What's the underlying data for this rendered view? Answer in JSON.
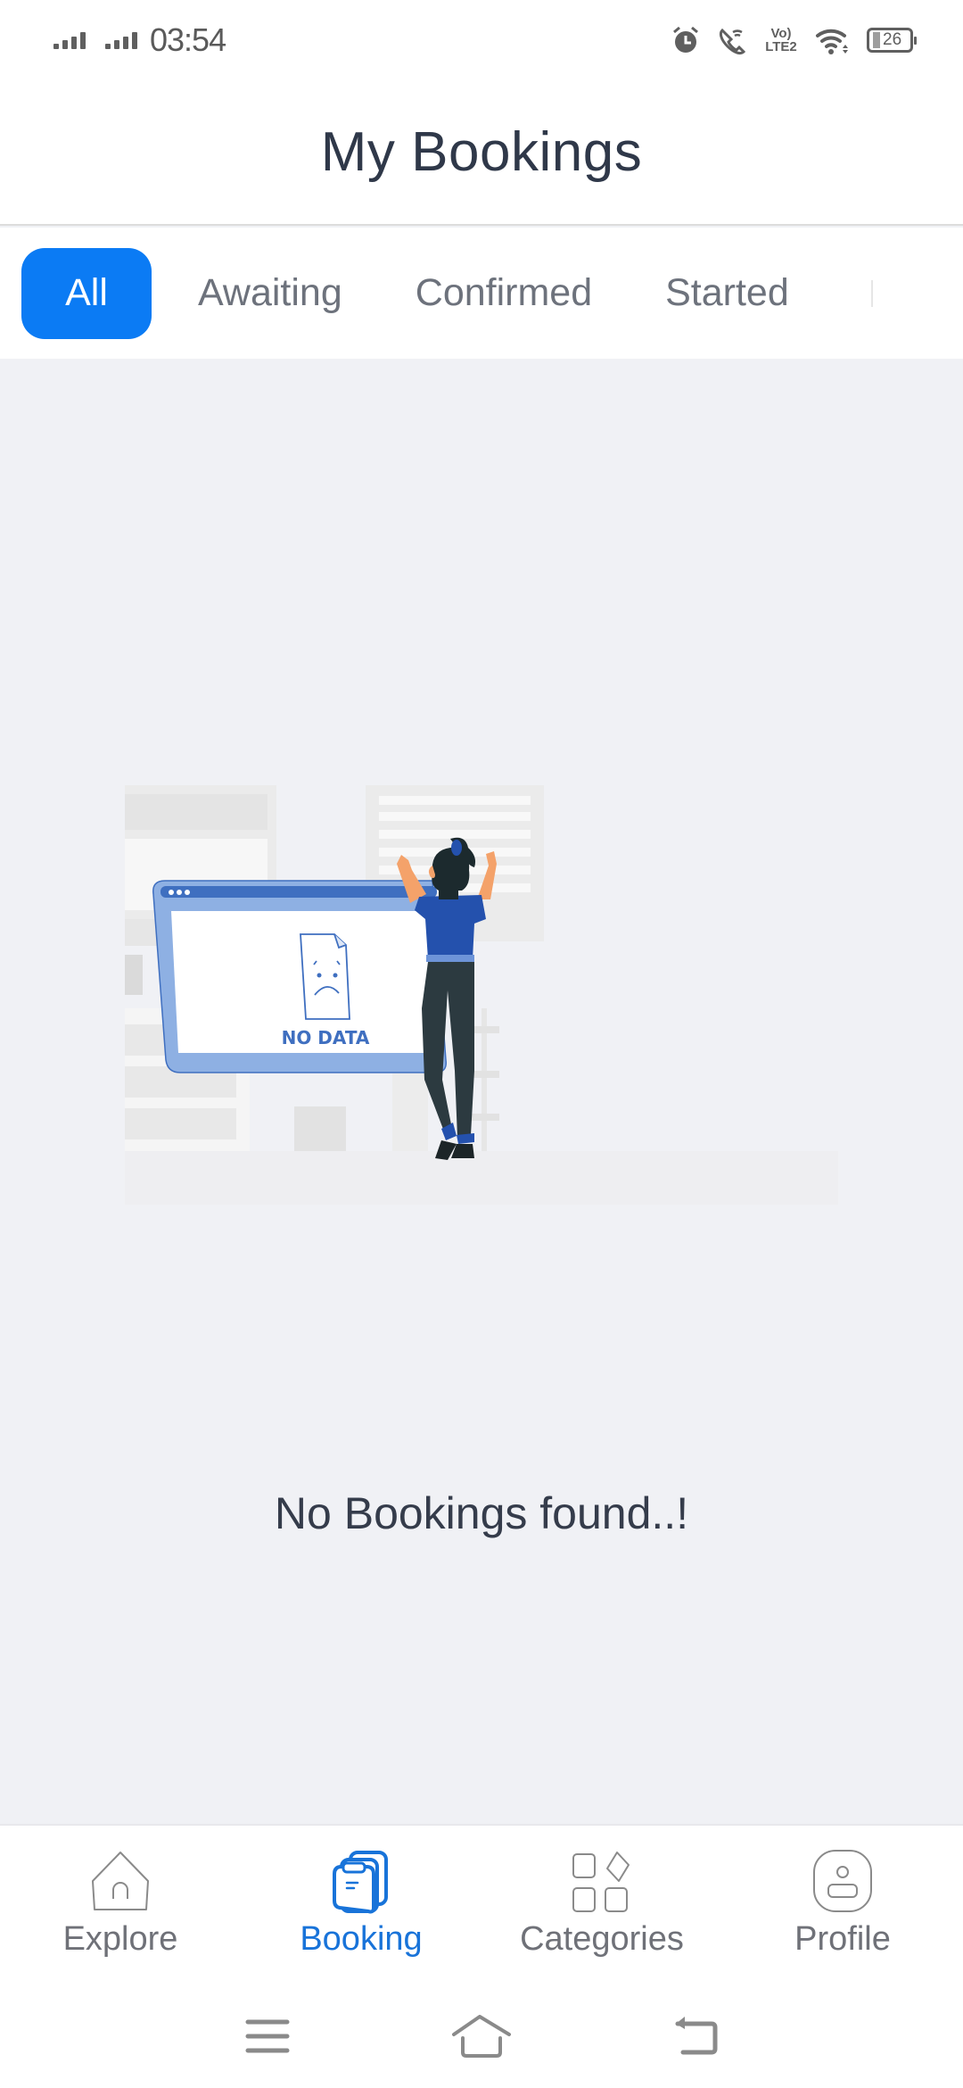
{
  "status_bar": {
    "time": "03:54",
    "battery_level": "26",
    "network_label": "Vo) LTE2",
    "icons": [
      "signal-sim1-icon",
      "signal-sim2-icon",
      "alarm-icon",
      "wifi-calling-icon",
      "volte-icon",
      "wifi-icon",
      "battery-icon"
    ]
  },
  "header": {
    "title": "My Bookings"
  },
  "tabs": {
    "active_index": 0,
    "items": [
      {
        "label": "All",
        "active": true
      },
      {
        "label": "Awaiting",
        "active": false
      },
      {
        "label": "Confirmed",
        "active": false
      },
      {
        "label": "Started",
        "active": false
      }
    ]
  },
  "empty_state": {
    "illustration_text": "NO DATA",
    "message": "No Bookings found..!",
    "colors": {
      "screen_frame": "#8eb0e3",
      "screen_bar": "#3f6fc0",
      "accent": "#2451ad",
      "pants": "#2c3a40",
      "skin": "#f4a26a"
    }
  },
  "bottom_nav": {
    "active_index": 1,
    "items": [
      {
        "label": "Explore",
        "icon": "home-icon"
      },
      {
        "label": "Booking",
        "icon": "clipboard-stack-icon"
      },
      {
        "label": "Categories",
        "icon": "categories-grid-icon"
      },
      {
        "label": "Profile",
        "icon": "profile-icon"
      }
    ]
  },
  "system_nav": {
    "buttons": [
      "menu-icon",
      "home-icon",
      "back-icon"
    ]
  },
  "colors": {
    "primary": "#0b7bf4",
    "nav_active": "#1873d9",
    "text_dark": "#2f3849",
    "text_muted": "#6d727c",
    "background": "#f0f1f5"
  }
}
